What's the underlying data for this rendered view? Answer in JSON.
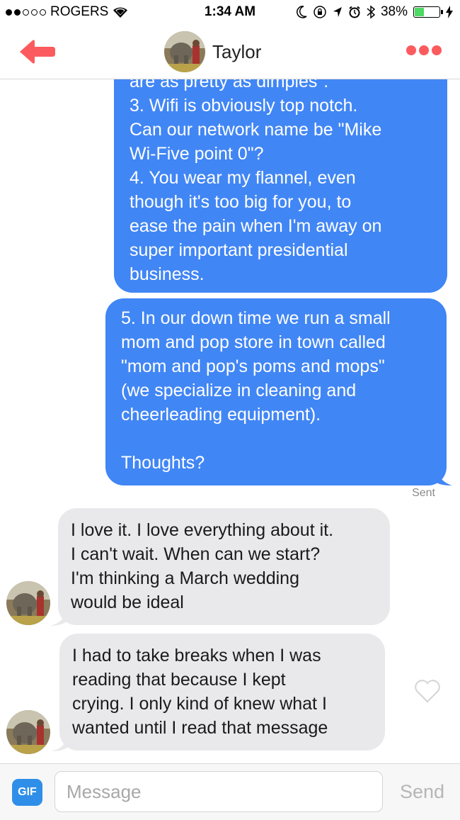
{
  "status_bar": {
    "carrier": "ROGERS",
    "time": "1:34 AM",
    "battery_percent": "38%",
    "battery_level": 0.38,
    "signal_bars_filled": 2,
    "signal_bars_total": 5
  },
  "header": {
    "contact_name": "Taylor",
    "back_icon": "back-arrow-icon",
    "more_icon": "more-dots-icon",
    "accent_color": "#fb5b5e"
  },
  "messages": [
    {
      "direction": "outgoing",
      "text": "are as pretty as dimples\".\n3. Wifi is obviously top notch.\nCan our network name be \"Mike\nWi-Five point 0\"?\n4. You wear my flannel, even\nthough it's too big for you, to\nease the pain when I'm away on\nsuper important presidential\nbusiness."
    },
    {
      "direction": "outgoing",
      "text": "5. In our down time we run a small\nmom and pop store in town called\n\"mom and pop's poms and mops\"\n(we specialize in cleaning and\ncheerleading equipment).\n\nThoughts?",
      "status": "Sent"
    },
    {
      "direction": "incoming",
      "text": "I love it. I love everything about it.\nI can't wait. When can we start?\nI'm thinking a March wedding\nwould be ideal"
    },
    {
      "direction": "incoming",
      "text": "I had to take breaks when I was\nreading that because I kept\ncrying. I only kind of knew what I\nwanted until I read that message"
    }
  ],
  "input_bar": {
    "gif_label": "GIF",
    "placeholder": "Message",
    "value": "",
    "send_label": "Send"
  },
  "colors": {
    "outgoing_bubble": "#4186f5",
    "incoming_bubble": "#e9e9eb",
    "gif_button": "#2f8fe8"
  }
}
